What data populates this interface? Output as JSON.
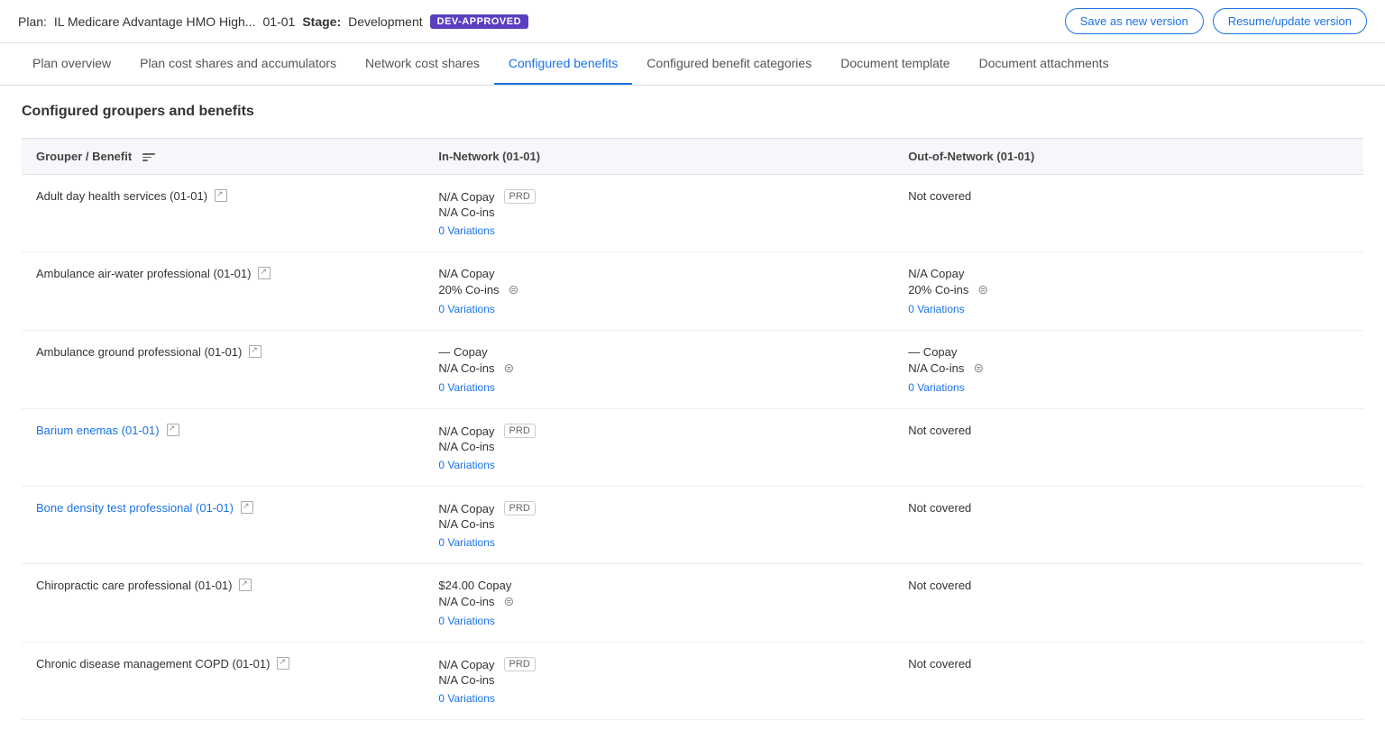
{
  "topBar": {
    "planLabel": "Plan:",
    "planName": "IL Medicare Advantage HMO High...",
    "planCode": "01-01",
    "stageLabel": "Stage:",
    "stageValue": "Development",
    "badge": "DEV-APPROVED",
    "buttons": {
      "saveAsNewVersion": "Save as new version",
      "resumeUpdateVersion": "Resume/update version"
    }
  },
  "tabs": [
    {
      "id": "plan-overview",
      "label": "Plan overview",
      "active": false
    },
    {
      "id": "plan-cost-shares",
      "label": "Plan cost shares and accumulators",
      "active": false
    },
    {
      "id": "network-cost-shares",
      "label": "Network cost shares",
      "active": false
    },
    {
      "id": "configured-benefits",
      "label": "Configured benefits",
      "active": true
    },
    {
      "id": "configured-benefit-categories",
      "label": "Configured benefit categories",
      "active": false
    },
    {
      "id": "document-template",
      "label": "Document template",
      "active": false
    },
    {
      "id": "document-attachments",
      "label": "Document attachments",
      "active": false
    }
  ],
  "sectionTitle": "Configured groupers and benefits",
  "tableHeaders": {
    "grouperBenefit": "Grouper / Benefit",
    "inNetwork": "In-Network (01-01)",
    "outOfNetwork": "Out-of-Network (01-01)"
  },
  "benefits": [
    {
      "name": "Adult day health services (01-01)",
      "linked": false,
      "inNetwork": {
        "copay": "N/A Copay",
        "coins": "N/A Co-ins",
        "badge": "PRD",
        "layers": false,
        "variations": "0 Variations"
      },
      "outOfNetwork": {
        "text": "Not covered"
      }
    },
    {
      "name": "Ambulance air-water professional (01-01)",
      "linked": false,
      "inNetwork": {
        "copay": "N/A Copay",
        "coins": "20% Co-ins",
        "badge": null,
        "layers": true,
        "variations": "0 Variations"
      },
      "outOfNetwork": {
        "copay": "N/A Copay",
        "coins": "20% Co-ins",
        "layers": true,
        "variations": "0 Variations"
      }
    },
    {
      "name": "Ambulance ground professional (01-01)",
      "linked": false,
      "inNetwork": {
        "copay": "— Copay",
        "coins": "N/A Co-ins",
        "badge": null,
        "layers": true,
        "variations": "0 Variations"
      },
      "outOfNetwork": {
        "copay": "— Copay",
        "coins": "N/A Co-ins",
        "layers": true,
        "variations": "0 Variations"
      }
    },
    {
      "name": "Barium enemas (01-01)",
      "linked": true,
      "inNetwork": {
        "copay": "N/A Copay",
        "coins": "N/A Co-ins",
        "badge": "PRD",
        "layers": false,
        "variations": "0 Variations"
      },
      "outOfNetwork": {
        "text": "Not covered"
      }
    },
    {
      "name": "Bone density test professional (01-01)",
      "linked": true,
      "inNetwork": {
        "copay": "N/A Copay",
        "coins": "N/A Co-ins",
        "badge": "PRD",
        "layers": false,
        "variations": "0 Variations"
      },
      "outOfNetwork": {
        "text": "Not covered"
      }
    },
    {
      "name": "Chiropractic care professional (01-01)",
      "linked": false,
      "inNetwork": {
        "copay": "$24.00 Copay",
        "coins": "N/A Co-ins",
        "badge": null,
        "layers": true,
        "variations": "0 Variations"
      },
      "outOfNetwork": {
        "text": "Not covered"
      }
    },
    {
      "name": "Chronic disease management COPD (01-01)",
      "linked": false,
      "inNetwork": {
        "copay": "N/A Copay",
        "coins": "N/A Co-ins",
        "badge": "PRD",
        "layers": false,
        "variations": "0 Variations"
      },
      "outOfNetwork": {
        "text": "Not covered"
      }
    }
  ]
}
